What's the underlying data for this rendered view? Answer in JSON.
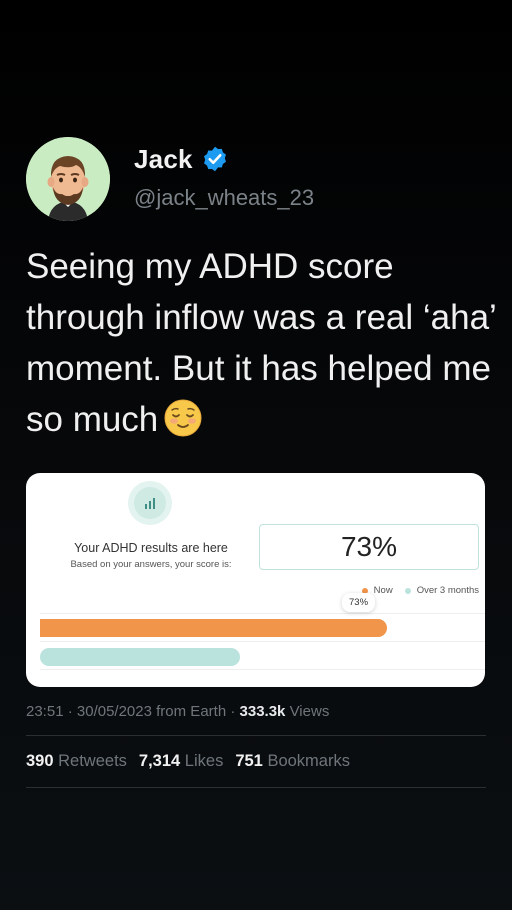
{
  "tweet": {
    "display_name": "Jack",
    "handle": "@jack_wheats_23",
    "text": "Seeing my ADHD score through inflow was a real ‘aha’ moment. But it has helped me so much",
    "emoji": "relieved-face-emoji"
  },
  "card": {
    "icon": "bar-chart-icon",
    "title": "Your ADHD results are here",
    "subtitle": "Based on your answers, your score is:",
    "score": "73%",
    "legend": {
      "now_label": "Now",
      "previous_label": "Over 3 months",
      "now_color": "#f0954a",
      "previous_color": "#b9e3dc"
    },
    "tooltip": "73%"
  },
  "chart_data": {
    "type": "bar",
    "orientation": "horizontal",
    "series": [
      {
        "name": "Now",
        "values": [
          73
        ]
      },
      {
        "name": "Over 3 months",
        "values": [
          42
        ]
      }
    ],
    "xlim": [
      0,
      100
    ],
    "legend_position": "top-right"
  },
  "meta": {
    "time": "23:51",
    "date": "30/05/2023",
    "source": "from Earth",
    "views_count": "333.3k",
    "views_label": "Views"
  },
  "stats": {
    "retweets_count": "390",
    "retweets_label": "Retweets",
    "likes_count": "7,314",
    "likes_label": "Likes",
    "bookmarks_count": "751",
    "bookmarks_label": "Bookmarks"
  },
  "colors": {
    "verified": "#1d9bf0",
    "avatar_bg": "#c9ecc2"
  }
}
